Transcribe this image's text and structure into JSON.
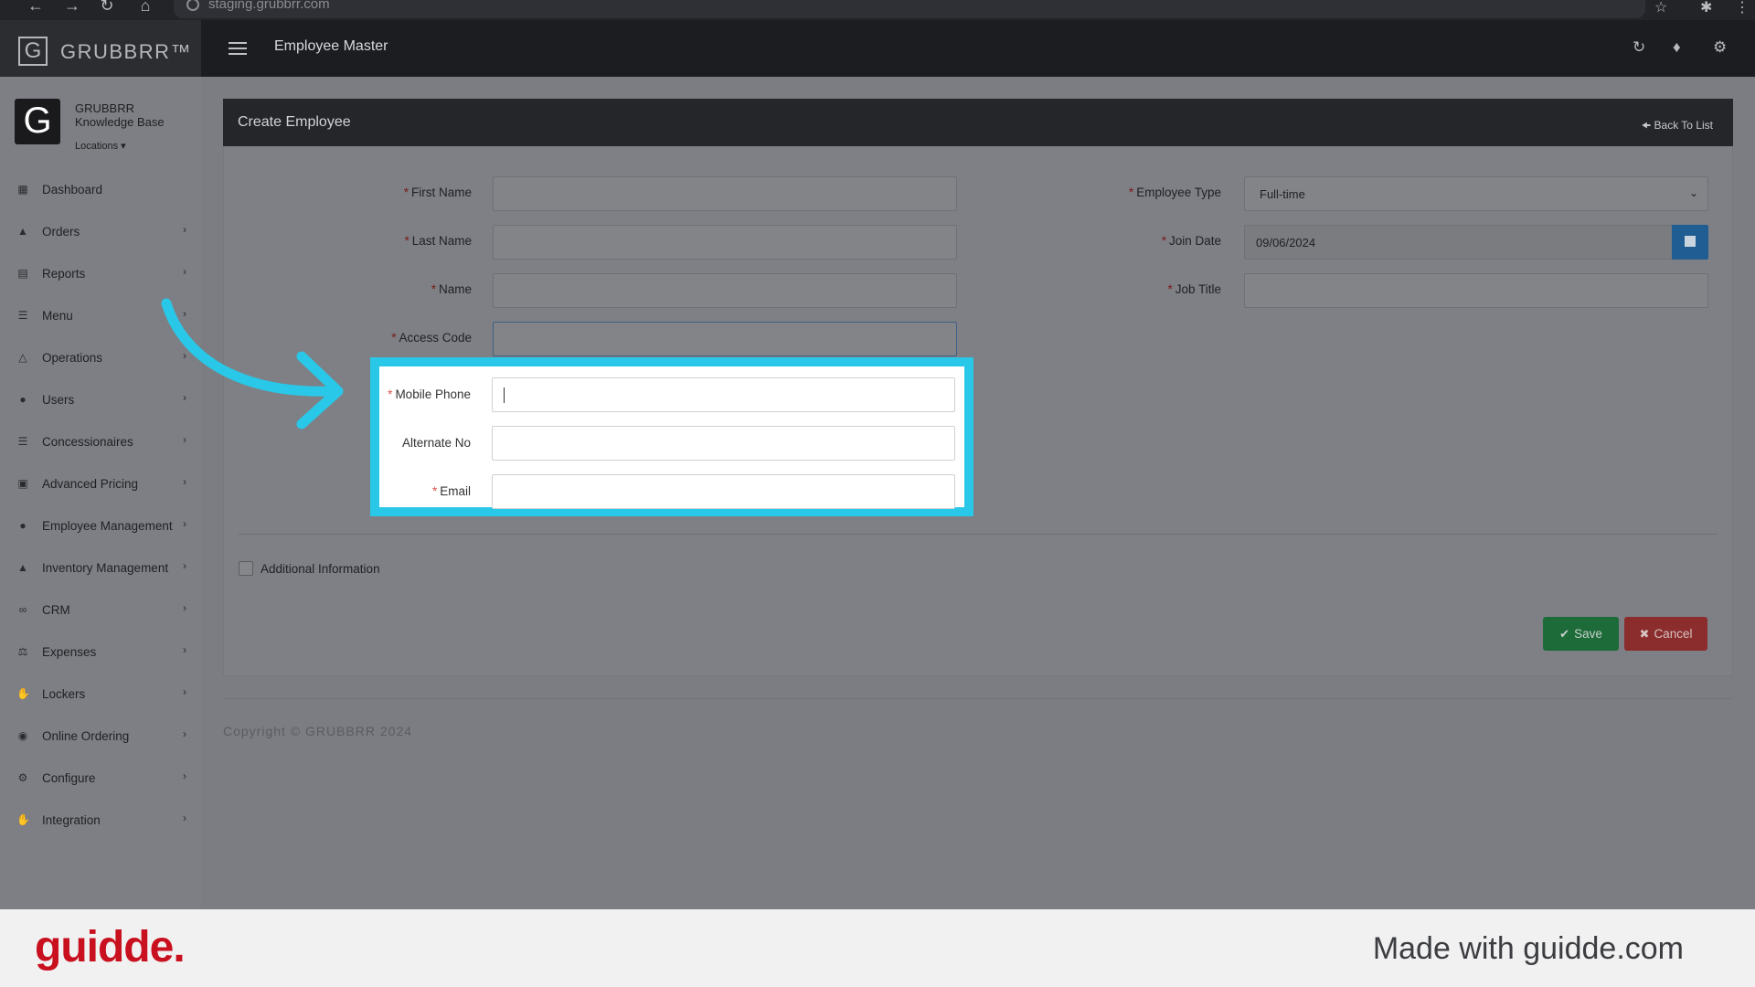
{
  "browser": {
    "url": "staging.grubbrr.com"
  },
  "app": {
    "logo_letter": "G",
    "logo_text": "GRUBBRR™",
    "page_title": "Employee Master"
  },
  "profile": {
    "name": "GRUBBRR Knowledge Base",
    "locations_label": "Locations"
  },
  "sidebar": {
    "items": [
      {
        "label": "Dashboard",
        "icon": "dashboard-icon",
        "has_submenu": false
      },
      {
        "label": "Orders",
        "icon": "cart-icon",
        "has_submenu": true
      },
      {
        "label": "Reports",
        "icon": "report-icon",
        "has_submenu": true
      },
      {
        "label": "Menu",
        "icon": "list-icon",
        "has_submenu": true
      },
      {
        "label": "Operations",
        "icon": "flask-icon",
        "has_submenu": true
      },
      {
        "label": "Users",
        "icon": "user-add-icon",
        "has_submenu": true
      },
      {
        "label": "Concessionaires",
        "icon": "list-icon",
        "has_submenu": true
      },
      {
        "label": "Advanced Pricing",
        "icon": "money-icon",
        "has_submenu": true
      },
      {
        "label": "Employee Management",
        "icon": "users-icon",
        "has_submenu": true
      },
      {
        "label": "Inventory Management",
        "icon": "sitemap-icon",
        "has_submenu": true
      },
      {
        "label": "CRM",
        "icon": "link-icon",
        "has_submenu": true
      },
      {
        "label": "Expenses",
        "icon": "balance-icon",
        "has_submenu": true
      },
      {
        "label": "Lockers",
        "icon": "hand-icon",
        "has_submenu": true
      },
      {
        "label": "Online Ordering",
        "icon": "globe-icon",
        "has_submenu": true
      },
      {
        "label": "Configure",
        "icon": "gear-icon",
        "has_submenu": true
      },
      {
        "label": "Integration",
        "icon": "hand-icon",
        "has_submenu": true
      }
    ]
  },
  "panel": {
    "title": "Create Employee",
    "back_label": "Back To List"
  },
  "form": {
    "first_name_label": "First Name",
    "last_name_label": "Last Name",
    "name_label": "Name",
    "access_code_label": "Access Code",
    "mobile_phone_label": "Mobile Phone",
    "alternate_no_label": "Alternate No",
    "email_label": "Email",
    "employee_type_label": "Employee Type",
    "employee_type_value": "Full-time",
    "join_date_label": "Join Date",
    "join_date_value": "09/06/2024",
    "job_title_label": "Job Title",
    "additional_info_label": "Additional Information",
    "save_label": "Save",
    "cancel_label": "Cancel"
  },
  "footer": {
    "copyright": "Copyright © GRUBBRR 2024"
  },
  "guidde": {
    "logo": "guidde.",
    "made_with": "Made with guidde.com"
  },
  "colors": {
    "highlight": "#29c8e8",
    "save": "#1d6b39",
    "cancel": "#8c2d2d",
    "calendar": "#1f5d92",
    "guidde_brand": "#c8101e"
  }
}
